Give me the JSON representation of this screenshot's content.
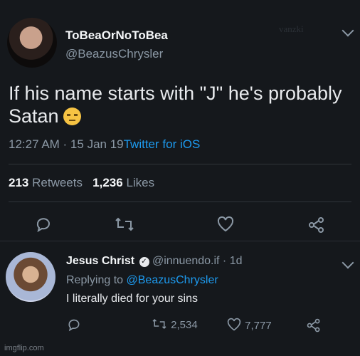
{
  "tweet": {
    "display_name": "ToBeaOrNoToBea",
    "handle": "@BeazusChrysler",
    "watermark": "vanzki",
    "text": "If his name starts with \"J\" he's probably Satan",
    "time_date": "12:27 AM · 15 Jan 19",
    "client": "Twitter for iOS",
    "retweets_count": "213",
    "retweets_label": "Retweets",
    "likes_count": "1,236",
    "likes_label": "Likes"
  },
  "reply": {
    "display_name": "Jesus Christ",
    "handle_time": "@innuendo.if · 1d",
    "replying_prefix": "Replying to",
    "replying_handle": "@BeazusChrysler",
    "text": "I literally died for your sins",
    "retweets": "2,534",
    "likes": "7,777"
  },
  "footer": {
    "watermark": "imgflip.com"
  },
  "icons": {
    "reply": "reply-icon",
    "retweet": "retweet-icon",
    "like": "heart-icon",
    "share": "share-icon",
    "emoji": "unamused-face-emoji",
    "verified": "verified-badge-icon"
  }
}
